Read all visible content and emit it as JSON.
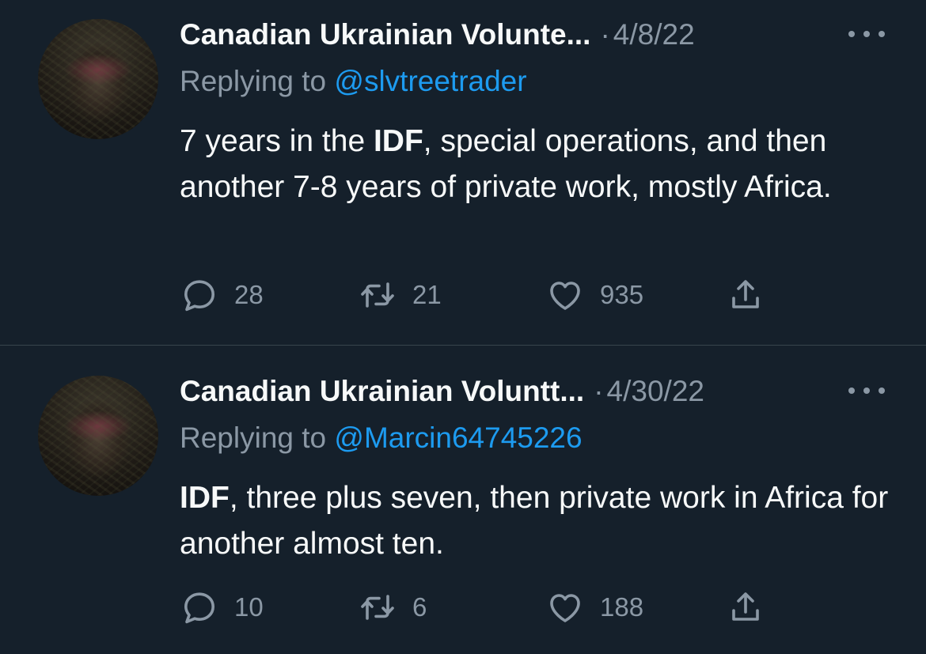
{
  "tweets": [
    {
      "author": "Canadian Ukrainian Volunte...",
      "separator": "·",
      "date": "4/8/22",
      "replying_prefix": "Replying to",
      "replying_handle": "@slvtreetrader",
      "body_parts": [
        "7 years in the ",
        "IDF",
        ", special operations, and then another 7-8 years of private work, mostly Africa."
      ],
      "replies": "28",
      "retweets": "21",
      "likes": "935"
    },
    {
      "author": "Canadian Ukrainian Voluntt...",
      "separator": "·",
      "date": "4/30/22",
      "replying_prefix": "Replying to",
      "replying_handle": "@Marcin64745226",
      "body_parts": [
        "IDF",
        ", three plus seven, then private work in Africa for another almost ten."
      ],
      "replies": "10",
      "retweets": "6",
      "likes": "188"
    }
  ],
  "icons": {
    "reply": "reply-icon",
    "retweet": "retweet-icon",
    "like": "heart-icon",
    "share": "share-icon",
    "more": "more-icon"
  },
  "colors": {
    "background": "#15202b",
    "text_primary": "#f7f9f9",
    "text_secondary": "#8b98a5",
    "link": "#1d9bf0",
    "divider": "#38444d"
  }
}
